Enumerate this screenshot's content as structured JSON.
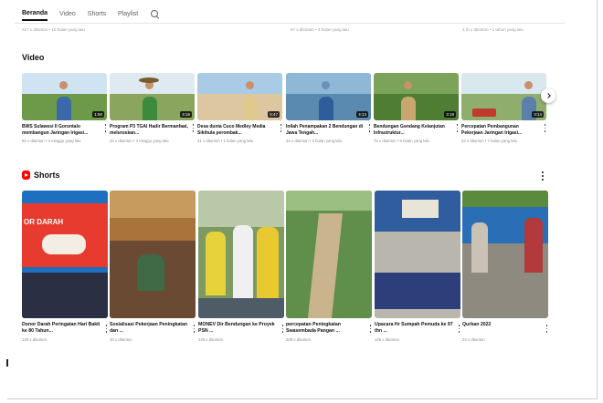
{
  "tabs": [
    {
      "label": "Beranda",
      "active": true
    },
    {
      "label": "Video",
      "active": false
    },
    {
      "label": "Shorts",
      "active": false
    },
    {
      "label": "Playlist",
      "active": false
    }
  ],
  "previous_row_meta": [
    "317 x ditonton • 10 bulan yang lalu",
    "67 x ditonton • 3 bulan yang lalu",
    "3 rb x ditonton • 1 tahun yang lalu"
  ],
  "video_section": {
    "title": "Video",
    "items": [
      {
        "title": "BWS Sulawesi II Gorontalo membangun Jaringan Irigasi...",
        "meta": "92 x ditonton • 4 minggu yang lalu",
        "duration": "1:50"
      },
      {
        "title": "Program P3 TGAI Hadir Bermanfaat, meluruskan...",
        "meta": "34 x ditonton • 4 minggu yang lalu",
        "duration": "4:16"
      },
      {
        "title": "Desa dunia Cuco Medley Media Sikihula perombak...",
        "meta": "41 x ditonton • 1 bulan yang lalu",
        "duration": "5:47"
      },
      {
        "title": "Inilah Penampakan 2 Bendungan di Jawa Tengah...",
        "meta": "34 x ditonton • 3 bulan yang lalu",
        "duration": "4:13"
      },
      {
        "title": "Bendungan Gondang Kelanjutan Infrastruktur...",
        "meta": "75 x ditonton • 5 bulan yang lalu",
        "duration": "3:18"
      },
      {
        "title": "Percepatan Pembangunan Pekerjaan Jaringan Irigasi...",
        "meta": "23 x ditonton • 7 bulan yang lalu",
        "duration": "3:14"
      }
    ]
  },
  "shorts_section": {
    "title": "Shorts",
    "items": [
      {
        "title": "Donor Darah Peringatan Hari Bakti ke 80 Tahun...",
        "meta": "140 x ditonton",
        "overlay_text": "OR DARAH"
      },
      {
        "title": "Sosialisasi Pekerjaan Peningkatan dan ...",
        "meta": "40 x ditonton",
        "overlay_text": ""
      },
      {
        "title": "MONEV Dir Bendungan ke Proyek PSN ...",
        "meta": "145 x ditonton",
        "overlay_text": ""
      },
      {
        "title": "percepatan Peningkatan Swasembada Pangan ...",
        "meta": "208 x ditonton",
        "overlay_text": ""
      },
      {
        "title": "Upacara Hr Sumpah Pemuda ke 97 thn ...",
        "meta": "145 x ditonton",
        "overlay_text": ""
      },
      {
        "title": "Qurban 2022",
        "meta": "24 x ditonton",
        "overlay_text": ""
      }
    ]
  },
  "icons": {
    "search": "search-icon",
    "next": "chevron-right-icon",
    "more": "more-vert-icon",
    "shorts": "shorts-logo-icon"
  },
  "colors": {
    "shorts_red": "#ff0000",
    "text_primary": "#0f0f0f",
    "text_secondary": "#606060"
  }
}
